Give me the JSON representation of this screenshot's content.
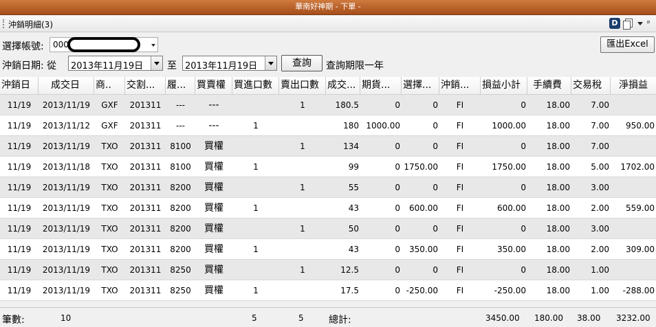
{
  "window": {
    "title": "華南好神期 - 下單 -"
  },
  "panel": {
    "title": "沖銷明細(3)",
    "d_label": "D",
    "pin_glyph": "ᵖ"
  },
  "account": {
    "label": "選擇帳號:",
    "value": "000"
  },
  "export_button": "匯出Excel",
  "date": {
    "label": "沖銷日期: 從",
    "from": "2013年11月19日",
    "to_label": "至",
    "to": "2013年11月19日"
  },
  "query_button": "查詢",
  "query_note": "查詢期限一年",
  "table": {
    "columns": [
      "沖銷日",
      "成交日",
      "商..",
      "交割...",
      "履...",
      "買賣權",
      "買進口數",
      "賣出口數",
      "成交...",
      "期貨...",
      "選擇...",
      "沖銷...",
      "損益小計",
      "手續費",
      "交易稅",
      "淨損益"
    ],
    "rows": [
      [
        "11/19",
        "2013/11/19",
        "GXF",
        "201311",
        "---",
        "---",
        "",
        "1",
        "180.5",
        "0",
        "0",
        "FI",
        "0",
        "18.00",
        "7.00",
        ""
      ],
      [
        "11/19",
        "2013/11/12",
        "GXF",
        "201311",
        "---",
        "---",
        "1",
        "",
        "180",
        "1000.00",
        "0",
        "FI",
        "1000.00",
        "18.00",
        "7.00",
        "950.00"
      ],
      [
        "11/19",
        "2013/11/19",
        "TXO",
        "201311",
        "8100",
        "買權",
        "",
        "1",
        "134",
        "0",
        "0",
        "FI",
        "0",
        "18.00",
        "7.00",
        ""
      ],
      [
        "11/19",
        "2013/11/18",
        "TXO",
        "201311",
        "8100",
        "買權",
        "1",
        "",
        "99",
        "0",
        "1750.00",
        "FI",
        "1750.00",
        "18.00",
        "5.00",
        "1702.00"
      ],
      [
        "11/19",
        "2013/11/19",
        "TXO",
        "201311",
        "8200",
        "買權",
        "",
        "1",
        "55",
        "0",
        "0",
        "FI",
        "0",
        "18.00",
        "3.00",
        ""
      ],
      [
        "11/19",
        "2013/11/19",
        "TXO",
        "201311",
        "8200",
        "買權",
        "1",
        "",
        "43",
        "0",
        "600.00",
        "FI",
        "600.00",
        "18.00",
        "2.00",
        "559.00"
      ],
      [
        "11/19",
        "2013/11/19",
        "TXO",
        "201311",
        "8200",
        "買權",
        "",
        "1",
        "50",
        "0",
        "0",
        "FI",
        "0",
        "18.00",
        "3.00",
        ""
      ],
      [
        "11/19",
        "2013/11/19",
        "TXO",
        "201311",
        "8200",
        "買權",
        "1",
        "",
        "43",
        "0",
        "350.00",
        "FI",
        "350.00",
        "18.00",
        "2.00",
        "309.00"
      ],
      [
        "11/19",
        "2013/11/19",
        "TXO",
        "201311",
        "8250",
        "買權",
        "",
        "1",
        "12.5",
        "0",
        "0",
        "FI",
        "0",
        "18.00",
        "1.00",
        ""
      ],
      [
        "11/19",
        "2013/11/19",
        "TXO",
        "201311",
        "8250",
        "買權",
        "1",
        "",
        "17.5",
        "0",
        "-250.00",
        "FI",
        "-250.00",
        "18.00",
        "1.00",
        "-288.00"
      ]
    ]
  },
  "summary": {
    "count_label": "筆數:",
    "count": "10",
    "buy_total": "5",
    "sell_total": "5",
    "total_label": "總計:",
    "pnl_total": "3450.00",
    "fee_total": "180.00",
    "tax_total": "38.00",
    "net_total": "3232.00"
  }
}
